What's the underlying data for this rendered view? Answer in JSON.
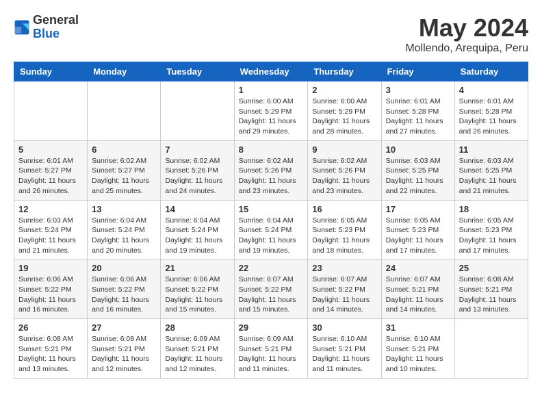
{
  "header": {
    "logo_general": "General",
    "logo_blue": "Blue",
    "month_year": "May 2024",
    "location": "Mollendo, Arequipa, Peru"
  },
  "days_of_week": [
    "Sunday",
    "Monday",
    "Tuesday",
    "Wednesday",
    "Thursday",
    "Friday",
    "Saturday"
  ],
  "weeks": [
    [
      {
        "day": "",
        "info": ""
      },
      {
        "day": "",
        "info": ""
      },
      {
        "day": "",
        "info": ""
      },
      {
        "day": "1",
        "info": "Sunrise: 6:00 AM\nSunset: 5:29 PM\nDaylight: 11 hours\nand 29 minutes."
      },
      {
        "day": "2",
        "info": "Sunrise: 6:00 AM\nSunset: 5:29 PM\nDaylight: 11 hours\nand 28 minutes."
      },
      {
        "day": "3",
        "info": "Sunrise: 6:01 AM\nSunset: 5:28 PM\nDaylight: 11 hours\nand 27 minutes."
      },
      {
        "day": "4",
        "info": "Sunrise: 6:01 AM\nSunset: 5:28 PM\nDaylight: 11 hours\nand 26 minutes."
      }
    ],
    [
      {
        "day": "5",
        "info": "Sunrise: 6:01 AM\nSunset: 5:27 PM\nDaylight: 11 hours\nand 26 minutes."
      },
      {
        "day": "6",
        "info": "Sunrise: 6:02 AM\nSunset: 5:27 PM\nDaylight: 11 hours\nand 25 minutes."
      },
      {
        "day": "7",
        "info": "Sunrise: 6:02 AM\nSunset: 5:26 PM\nDaylight: 11 hours\nand 24 minutes."
      },
      {
        "day": "8",
        "info": "Sunrise: 6:02 AM\nSunset: 5:26 PM\nDaylight: 11 hours\nand 23 minutes."
      },
      {
        "day": "9",
        "info": "Sunrise: 6:02 AM\nSunset: 5:26 PM\nDaylight: 11 hours\nand 23 minutes."
      },
      {
        "day": "10",
        "info": "Sunrise: 6:03 AM\nSunset: 5:25 PM\nDaylight: 11 hours\nand 22 minutes."
      },
      {
        "day": "11",
        "info": "Sunrise: 6:03 AM\nSunset: 5:25 PM\nDaylight: 11 hours\nand 21 minutes."
      }
    ],
    [
      {
        "day": "12",
        "info": "Sunrise: 6:03 AM\nSunset: 5:24 PM\nDaylight: 11 hours\nand 21 minutes."
      },
      {
        "day": "13",
        "info": "Sunrise: 6:04 AM\nSunset: 5:24 PM\nDaylight: 11 hours\nand 20 minutes."
      },
      {
        "day": "14",
        "info": "Sunrise: 6:04 AM\nSunset: 5:24 PM\nDaylight: 11 hours\nand 19 minutes."
      },
      {
        "day": "15",
        "info": "Sunrise: 6:04 AM\nSunset: 5:24 PM\nDaylight: 11 hours\nand 19 minutes."
      },
      {
        "day": "16",
        "info": "Sunrise: 6:05 AM\nSunset: 5:23 PM\nDaylight: 11 hours\nand 18 minutes."
      },
      {
        "day": "17",
        "info": "Sunrise: 6:05 AM\nSunset: 5:23 PM\nDaylight: 11 hours\nand 17 minutes."
      },
      {
        "day": "18",
        "info": "Sunrise: 6:05 AM\nSunset: 5:23 PM\nDaylight: 11 hours\nand 17 minutes."
      }
    ],
    [
      {
        "day": "19",
        "info": "Sunrise: 6:06 AM\nSunset: 5:22 PM\nDaylight: 11 hours\nand 16 minutes."
      },
      {
        "day": "20",
        "info": "Sunrise: 6:06 AM\nSunset: 5:22 PM\nDaylight: 11 hours\nand 16 minutes."
      },
      {
        "day": "21",
        "info": "Sunrise: 6:06 AM\nSunset: 5:22 PM\nDaylight: 11 hours\nand 15 minutes."
      },
      {
        "day": "22",
        "info": "Sunrise: 6:07 AM\nSunset: 5:22 PM\nDaylight: 11 hours\nand 15 minutes."
      },
      {
        "day": "23",
        "info": "Sunrise: 6:07 AM\nSunset: 5:22 PM\nDaylight: 11 hours\nand 14 minutes."
      },
      {
        "day": "24",
        "info": "Sunrise: 6:07 AM\nSunset: 5:21 PM\nDaylight: 11 hours\nand 14 minutes."
      },
      {
        "day": "25",
        "info": "Sunrise: 6:08 AM\nSunset: 5:21 PM\nDaylight: 11 hours\nand 13 minutes."
      }
    ],
    [
      {
        "day": "26",
        "info": "Sunrise: 6:08 AM\nSunset: 5:21 PM\nDaylight: 11 hours\nand 13 minutes."
      },
      {
        "day": "27",
        "info": "Sunrise: 6:08 AM\nSunset: 5:21 PM\nDaylight: 11 hours\nand 12 minutes."
      },
      {
        "day": "28",
        "info": "Sunrise: 6:09 AM\nSunset: 5:21 PM\nDaylight: 11 hours\nand 12 minutes."
      },
      {
        "day": "29",
        "info": "Sunrise: 6:09 AM\nSunset: 5:21 PM\nDaylight: 11 hours\nand 11 minutes."
      },
      {
        "day": "30",
        "info": "Sunrise: 6:10 AM\nSunset: 5:21 PM\nDaylight: 11 hours\nand 11 minutes."
      },
      {
        "day": "31",
        "info": "Sunrise: 6:10 AM\nSunset: 5:21 PM\nDaylight: 11 hours\nand 10 minutes."
      },
      {
        "day": "",
        "info": ""
      }
    ]
  ]
}
